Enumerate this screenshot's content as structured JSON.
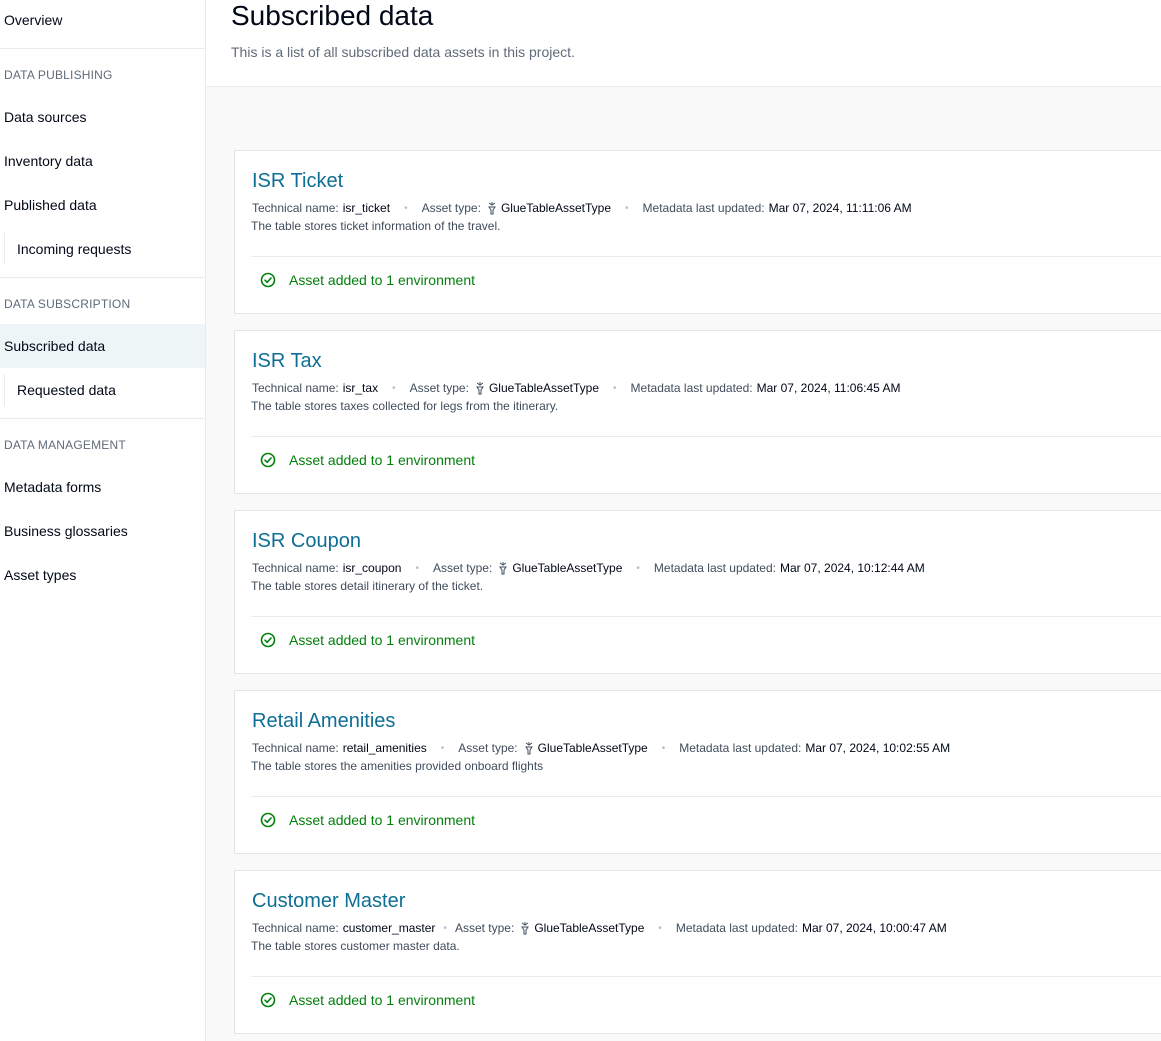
{
  "sidebar": {
    "overview": "Overview",
    "sections": {
      "publishing": "DATA PUBLISHING",
      "subscription": "DATA SUBSCRIPTION",
      "management": "DATA MANAGEMENT"
    },
    "items": {
      "data_sources": "Data sources",
      "inventory_data": "Inventory data",
      "published_data": "Published data",
      "incoming_requests": "Incoming requests",
      "subscribed_data": "Subscribed data",
      "requested_data": "Requested data",
      "metadata_forms": "Metadata forms",
      "business_glossaries": "Business glossaries",
      "asset_types": "Asset types"
    }
  },
  "header": {
    "title": "Subscribed data",
    "description": "This is a list of all subscribed data assets in this project."
  },
  "labels": {
    "technical_name": "Technical name:",
    "asset_type": "Asset type:",
    "metadata_updated": "Metadata last updated:"
  },
  "assets": [
    {
      "title": "ISR Ticket",
      "technical_name": "isr_ticket",
      "asset_type": "GlueTableAssetType",
      "updated": "Mar 07, 2024, 11:11:06 AM",
      "description": "The table stores ticket information of the travel.",
      "status": "Asset added to 1 environment"
    },
    {
      "title": "ISR Tax",
      "technical_name": "isr_tax",
      "asset_type": "GlueTableAssetType",
      "updated": "Mar 07, 2024, 11:06:45 AM",
      "description": "The table stores taxes collected for legs from the itinerary.",
      "status": "Asset added to 1 environment"
    },
    {
      "title": "ISR Coupon",
      "technical_name": "isr_coupon",
      "asset_type": "GlueTableAssetType",
      "updated": "Mar 07, 2024, 10:12:44 AM",
      "description": "The table stores detail itinerary of the ticket.",
      "status": "Asset added to 1 environment"
    },
    {
      "title": "Retail Amenities",
      "technical_name": "retail_amenities",
      "asset_type": "GlueTableAssetType",
      "updated": "Mar 07, 2024, 10:02:55 AM",
      "description": "The table stores the amenities provided onboard flights",
      "status": "Asset added to 1 environment"
    },
    {
      "title": "Customer Master",
      "technical_name": "customer_master",
      "asset_type": "GlueTableAssetType",
      "updated": "Mar 07, 2024, 10:00:47 AM",
      "description": "The table stores customer master data.",
      "status": "Asset added to 1 environment"
    }
  ],
  "icons": {
    "asset_type": "glue-asset-icon",
    "status": "check-circle-icon"
  },
  "colors": {
    "link": "#0f6e94",
    "success": "#037f0c",
    "active_nav_bg": "#eef5f7"
  }
}
